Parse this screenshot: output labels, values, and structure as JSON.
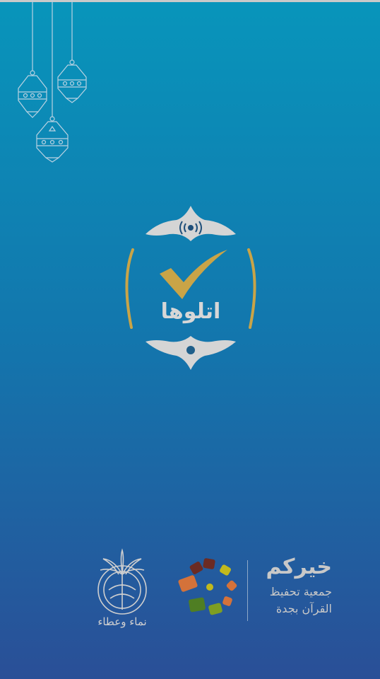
{
  "splash": {
    "app_name": "اتلوها",
    "sponsor_motto": "نماء وعطاء",
    "org_brand": "خيركم",
    "org_name_line1": "جمعية تحفيظ",
    "org_name_line2": "القرآن بجدة"
  },
  "colors": {
    "background_top": "#0895bb",
    "background_bottom": "#2a4f97",
    "logo_grey": "#d5d5d5",
    "logo_gold": "#c9a447",
    "flower_petals": [
      "#6b2b23",
      "#c1b91d",
      "#d4723a",
      "#4f7e23",
      "#7e9e22"
    ]
  },
  "icons": [
    "lantern-icon",
    "wifi-signal-icon",
    "checkmark-icon",
    "flower-logo-icon",
    "palm-emblem-icon"
  ]
}
